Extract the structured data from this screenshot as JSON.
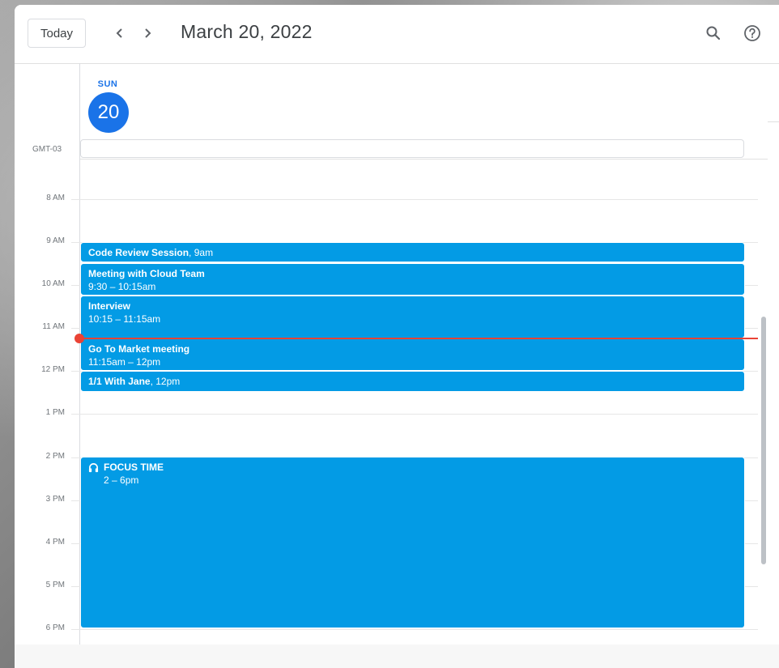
{
  "header": {
    "today_label": "Today",
    "prev_glyph": "‹",
    "next_glyph": "›",
    "date_title": "March 20, 2022",
    "search_icon": "search-icon",
    "help_icon": "help-icon"
  },
  "day": {
    "name": "SUN",
    "number": "20"
  },
  "timezone": "GMT-03",
  "hours": [
    "8 AM",
    "9 AM",
    "10 AM",
    "11 AM",
    "12 PM",
    "1 PM",
    "2 PM",
    "3 PM",
    "4 PM",
    "5 PM",
    "6 PM"
  ],
  "events": [
    {
      "title": "Code Review Session",
      "time": ", 9am"
    },
    {
      "title": "Meeting with Cloud Team",
      "time": "9:30 – 10:15am"
    },
    {
      "title": "Interview",
      "time": "10:15 – 11:15am"
    },
    {
      "title": "Go To Market meeting",
      "time": "11:15am – 12pm"
    },
    {
      "title": "1/1 With Jane",
      "time": ", 12pm"
    },
    {
      "title": "FOCUS TIME",
      "time": "2 – 6pm",
      "icon": "headphones-icon"
    }
  ],
  "colors": {
    "accent": "#1a73e8",
    "event": "#039be5",
    "now_indicator": "#ea4335"
  }
}
